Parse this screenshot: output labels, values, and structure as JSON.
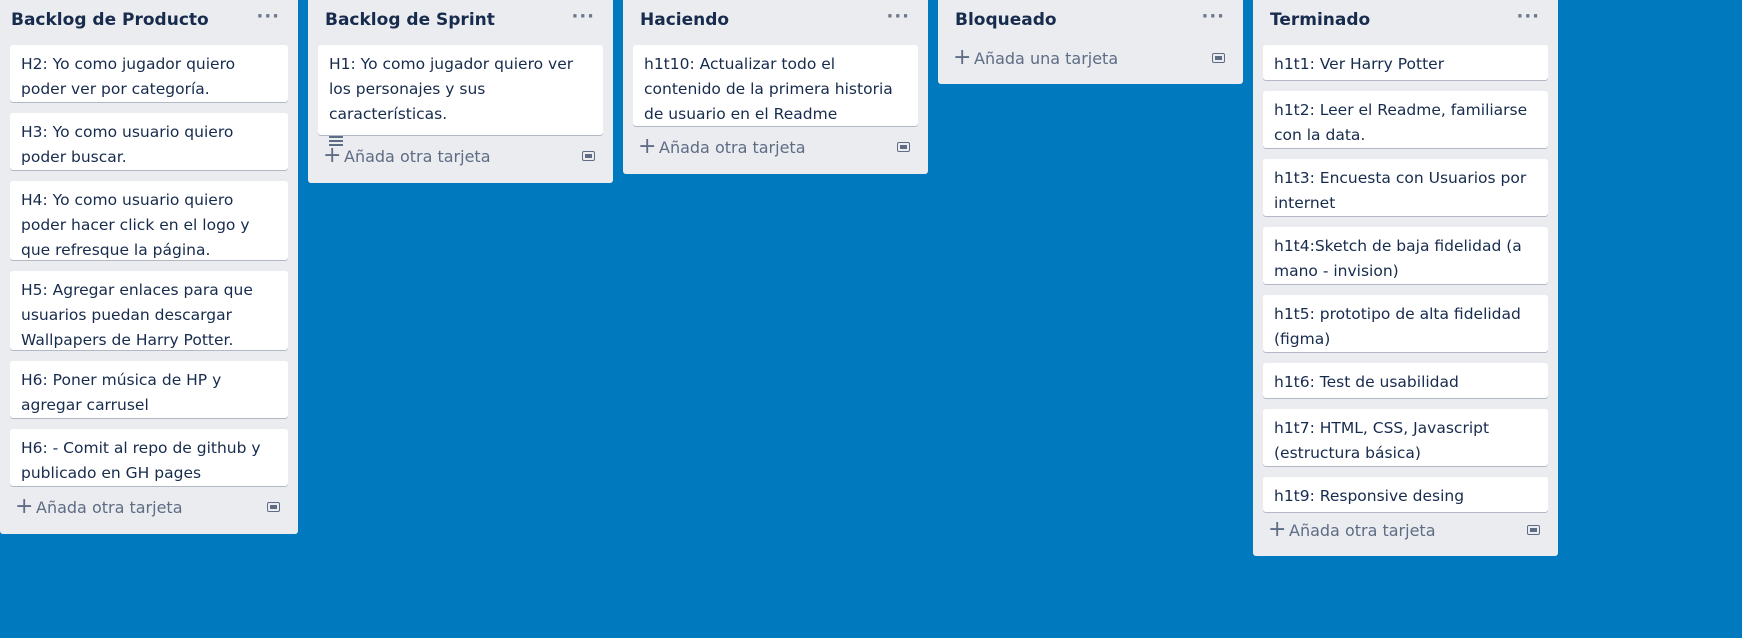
{
  "lists": [
    {
      "title": "Backlog de Producto",
      "menu": "···",
      "cards": [
        {
          "text": "H2: Yo como jugador quiero poder ver por categoría."
        },
        {
          "text": "H3: Yo como usuario quiero poder buscar."
        },
        {
          "text": "H4: Yo como usuario quiero poder hacer click en el logo y que refresque la página."
        },
        {
          "text": "H5: Agregar enlaces para que usuarios puedan descargar Wallpapers de Harry Potter."
        },
        {
          "text": "H6: Poner música de HP y agregar carrusel"
        },
        {
          "text": "H6: - Comit al repo de github y publicado en GH pages"
        }
      ],
      "add_label": "Añada otra tarjeta"
    },
    {
      "title": "Backlog de Sprint",
      "menu": "···",
      "cards": [
        {
          "text": "H1: Yo como jugador quiero ver los personajes y sus características.",
          "has_description": true
        }
      ],
      "add_label": "Añada otra tarjeta"
    },
    {
      "title": "Haciendo",
      "menu": "···",
      "cards": [
        {
          "text": "h1t10: Actualizar todo el contenido de la primera historia de usuario en el Readme"
        }
      ],
      "add_label": "Añada otra tarjeta"
    },
    {
      "title": "Bloqueado",
      "menu": "···",
      "cards": [],
      "add_label": "Añada una tarjeta"
    },
    {
      "title": "Terminado",
      "menu": "···",
      "cards": [
        {
          "text": "h1t1: Ver Harry Potter"
        },
        {
          "text": "h1t2: Leer el Readme, familiarse con la data."
        },
        {
          "text": "h1t3: Encuesta con Usuarios por internet"
        },
        {
          "text": "h1t4:Sketch de baja fidelidad (a mano - invision)"
        },
        {
          "text": "h1t5: prototipo de alta fidelidad (figma)"
        },
        {
          "text": "h1t6: Test de usabilidad"
        },
        {
          "text": "h1t7: HTML, CSS, Javascript (estructura básica)"
        },
        {
          "text": "h1t9: Responsive desing"
        }
      ],
      "add_label": "Añada otra tarjeta"
    }
  ],
  "colors": {
    "board_background": "#0079bf",
    "list_background": "#ebecf0",
    "card_background": "#ffffff",
    "text": "#172b4d",
    "muted": "#5e6c84"
  }
}
